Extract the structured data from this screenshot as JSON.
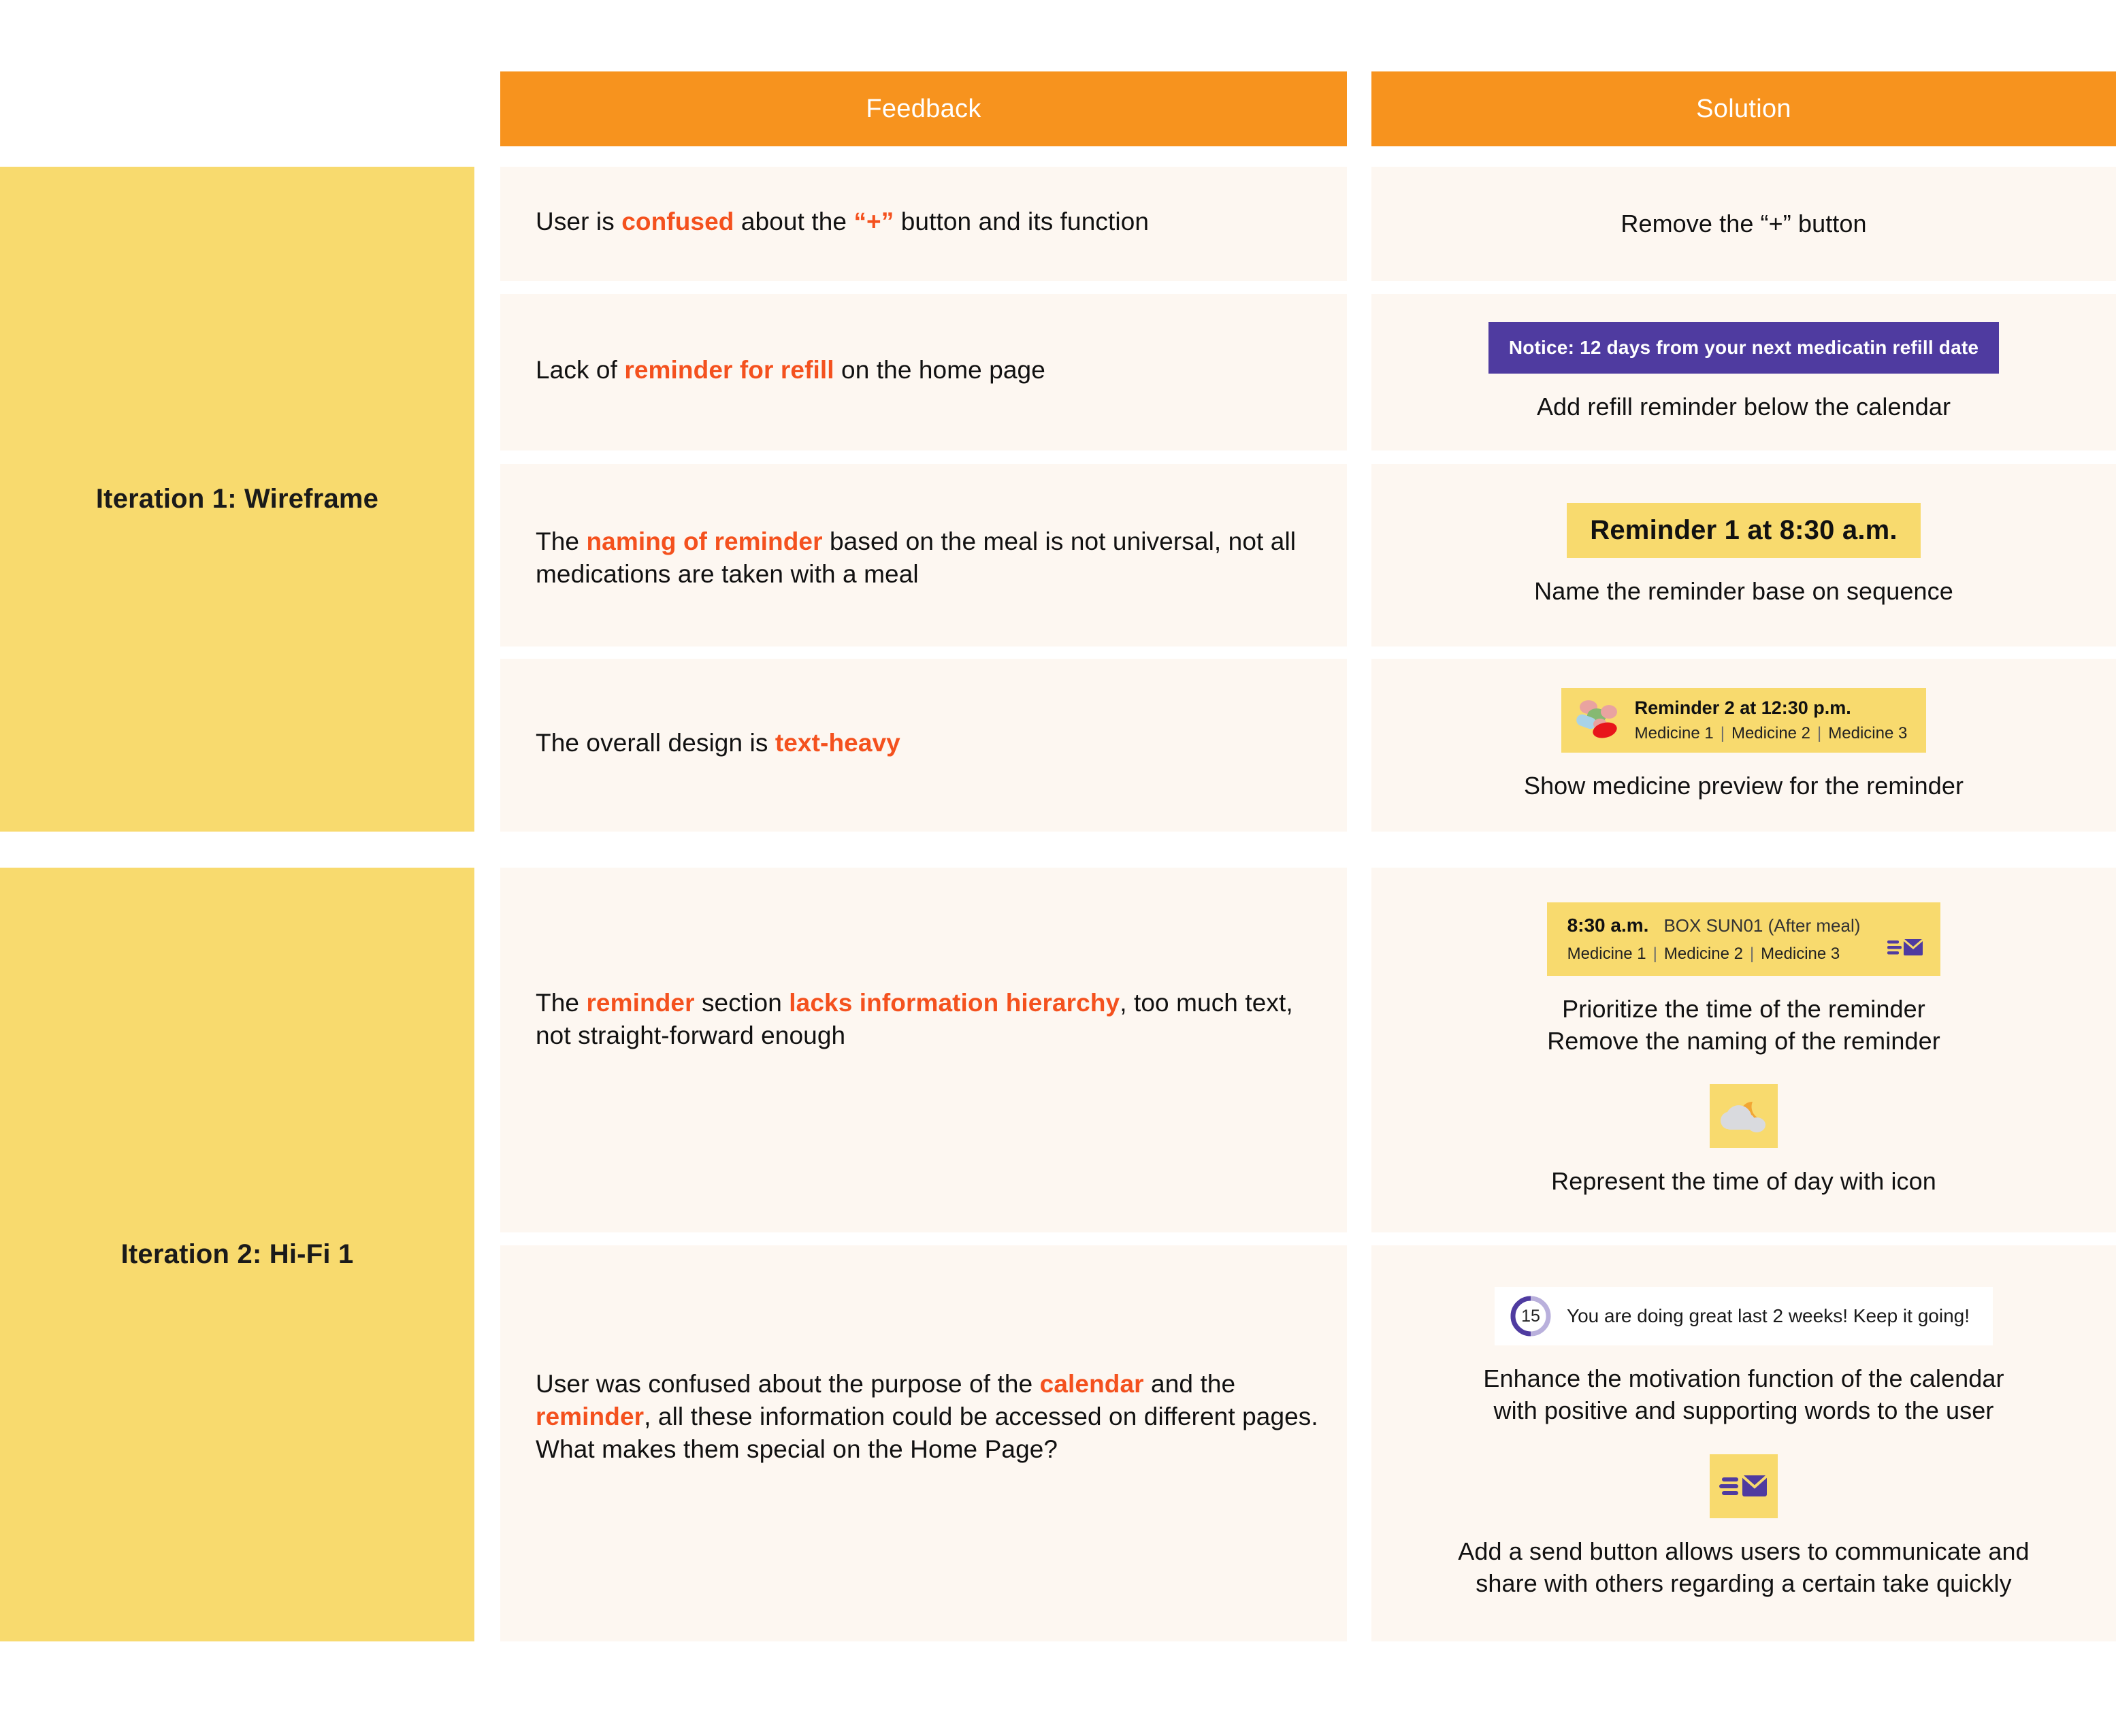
{
  "colors": {
    "header_orange": "#f7931e",
    "iteration_yellow": "#f8da6e",
    "cell_cream": "#fdf7f1",
    "highlight_orange": "#f4511e",
    "notice_purple": "#4f3ba0",
    "page_white": "#ffffff"
  },
  "headers": {
    "feedback": "Feedback",
    "solution": "Solution"
  },
  "iterations": [
    {
      "label": "Iteration 1: Wireframe"
    },
    {
      "label": "Iteration 2: Hi-Fi 1"
    }
  ],
  "rows": [
    {
      "id": "row-plus-button",
      "feedback": {
        "parts": [
          {
            "text": "User is ",
            "highlight": false
          },
          {
            "text": "confused",
            "highlight": true
          },
          {
            "text": " about the ",
            "highlight": false
          },
          {
            "text": "“+”",
            "highlight": true
          },
          {
            "text": " button and its function",
            "highlight": false
          }
        ]
      },
      "solution": {
        "caption": "Remove the “+” button"
      }
    },
    {
      "id": "row-refill-reminder",
      "feedback": {
        "parts": [
          {
            "text": "Lack of ",
            "highlight": false
          },
          {
            "text": "reminder for refill",
            "highlight": true
          },
          {
            "text": " on the home page",
            "highlight": false
          }
        ]
      },
      "solution": {
        "notice_banner": "Notice: 12 days from your next medicatin refill date",
        "caption": "Add refill reminder below the calendar"
      }
    },
    {
      "id": "row-reminder-naming",
      "feedback": {
        "parts": [
          {
            "text": "The ",
            "highlight": false
          },
          {
            "text": "naming of reminder",
            "highlight": true
          },
          {
            "text": " based on the meal is not universal, not all medications are taken with a meal",
            "highlight": false
          }
        ]
      },
      "solution": {
        "chip": "Reminder 1 at 8:30 a.m.",
        "caption": "Name the reminder base on sequence"
      }
    },
    {
      "id": "row-text-heavy",
      "feedback": {
        "parts": [
          {
            "text": "The overall design is ",
            "highlight": false
          },
          {
            "text": "text-heavy",
            "highlight": true
          }
        ]
      },
      "solution": {
        "medicine_card": {
          "title": "Reminder 2 at 12:30 p.m.",
          "medicines": [
            "Medicine 1",
            "Medicine 2",
            "Medicine 3"
          ],
          "separator": "|",
          "icon": "pills-icon"
        },
        "caption": "Show medicine preview for the reminder"
      }
    },
    {
      "id": "row-information-hierarchy",
      "feedback": {
        "parts": [
          {
            "text": "The ",
            "highlight": false
          },
          {
            "text": "reminder",
            "highlight": true
          },
          {
            "text": " section ",
            "highlight": false
          },
          {
            "text": "lacks information hierarchy",
            "highlight": true
          },
          {
            "text": ", too much text, not straight-forward enough",
            "highlight": false
          }
        ]
      },
      "solution": {
        "box_card": {
          "time": "8:30 a.m.",
          "box_name": "BOX SUN01 (After meal)",
          "medicines": [
            "Medicine 1",
            "Medicine 2",
            "Medicine 3"
          ],
          "separator": "|",
          "send_icon": "send-mail-icon"
        },
        "caption_line1": "Prioritize the time of the reminder",
        "caption_line2": "Remove the naming of the reminder",
        "time_of_day_icon": "cloud-moon-icon",
        "caption2": "Represent the time of day with icon"
      }
    },
    {
      "id": "row-calendar-purpose",
      "feedback": {
        "parts": [
          {
            "text": "User was confused about the purpose of the  ",
            "highlight": false
          },
          {
            "text": "calendar",
            "highlight": true
          },
          {
            "text": " and the ",
            "highlight": false
          },
          {
            "text": "reminder",
            "highlight": true
          },
          {
            "text": ", all these information could be accessed on different pages. What makes them special on the Home Page?",
            "highlight": false
          }
        ]
      },
      "solution": {
        "motivation_banner": {
          "streak_count": "15",
          "message": "You are doing great last 2 weeks! Keep it going!"
        },
        "caption_line1": "Enhance the motivation function of the calendar",
        "caption_line2": "with positive and supporting words to the user",
        "send_button_icon": "send-mail-icon",
        "caption2_line1": "Add a send button allows users to communicate and",
        "caption2_line2": "share with others regarding a certain take quickly"
      }
    }
  ]
}
